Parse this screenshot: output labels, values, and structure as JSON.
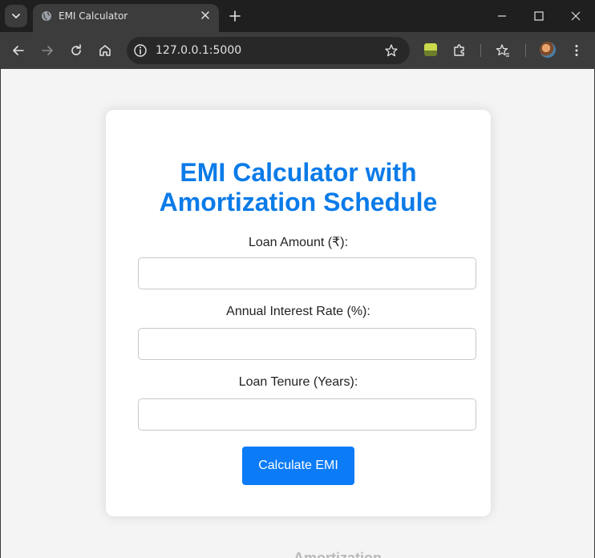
{
  "browser": {
    "tab_title": "EMI Calculator",
    "url": "127.0.0.1:5000"
  },
  "page": {
    "heading": "EMI Calculator with Amortization Schedule",
    "fields": [
      {
        "label": "Loan Amount (₹):",
        "value": ""
      },
      {
        "label": "Annual Interest Rate (%):",
        "value": ""
      },
      {
        "label": "Loan Tenure (Years):",
        "value": ""
      }
    ],
    "submit_label": "Calculate EMI",
    "bottom_partial_text": "Amortization Schedule"
  },
  "colors": {
    "accent": "#0b7be8",
    "button": "#0b7bf7",
    "page_bg": "#f4f4f4",
    "card_bg": "#ffffff"
  }
}
